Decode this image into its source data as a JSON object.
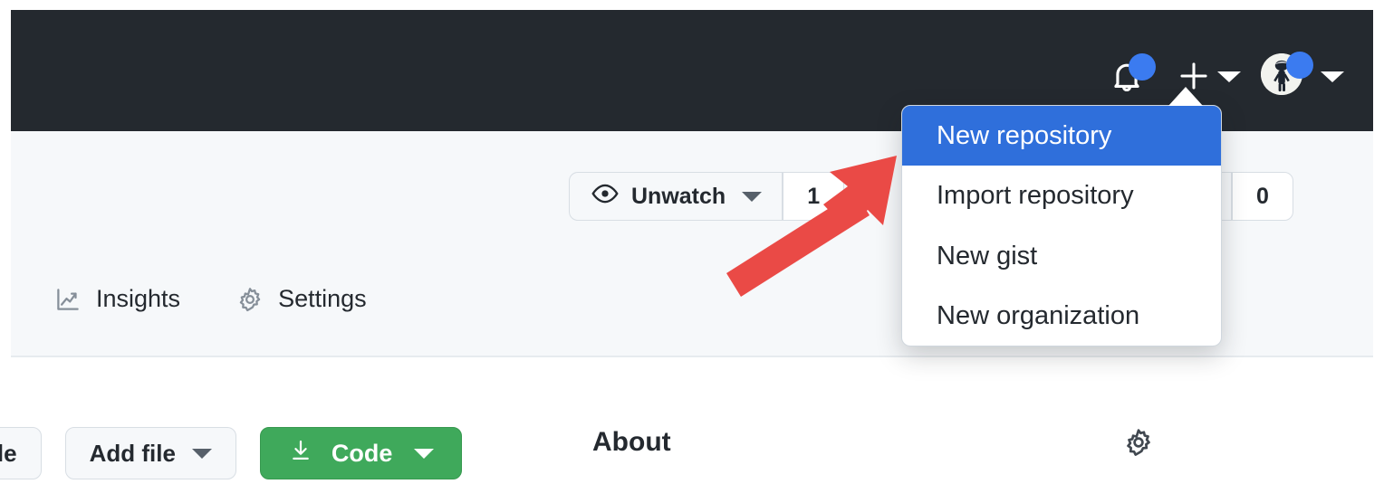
{
  "topbar": {
    "notifications_icon": "bell-icon",
    "notification_badge": "unread-dot",
    "create_new_icon": "plus-icon",
    "account_avatar": "avatar",
    "account_badge": "status-dot"
  },
  "create_menu": {
    "items": [
      {
        "label": "New repository",
        "selected": true
      },
      {
        "label": "Import repository",
        "selected": false
      },
      {
        "label": "New gist",
        "selected": false
      },
      {
        "label": "New organization",
        "selected": false
      }
    ],
    "highlight_color": "#2f6fdb"
  },
  "repo_actions": {
    "watch": {
      "label": "Unwatch",
      "icon": "eye-icon",
      "count": "1"
    },
    "fork": {
      "icon": "fork-icon",
      "count": "0"
    }
  },
  "repo_nav": {
    "items": [
      {
        "label": "Insights",
        "icon": "graph-icon"
      },
      {
        "label": "Settings",
        "icon": "gear-icon"
      }
    ]
  },
  "file_toolbar": {
    "go_to_file_label": "file",
    "add_file_label": "Add file",
    "code_label": "Code",
    "code_icon": "download-icon",
    "code_color": "#3fa95b"
  },
  "about": {
    "title": "About",
    "settings_icon": "gear-icon"
  },
  "annotation": {
    "arrow_color": "#ea4a46",
    "arrow_from": "(800, 296)",
    "arrow_to": "(985, 176)"
  }
}
